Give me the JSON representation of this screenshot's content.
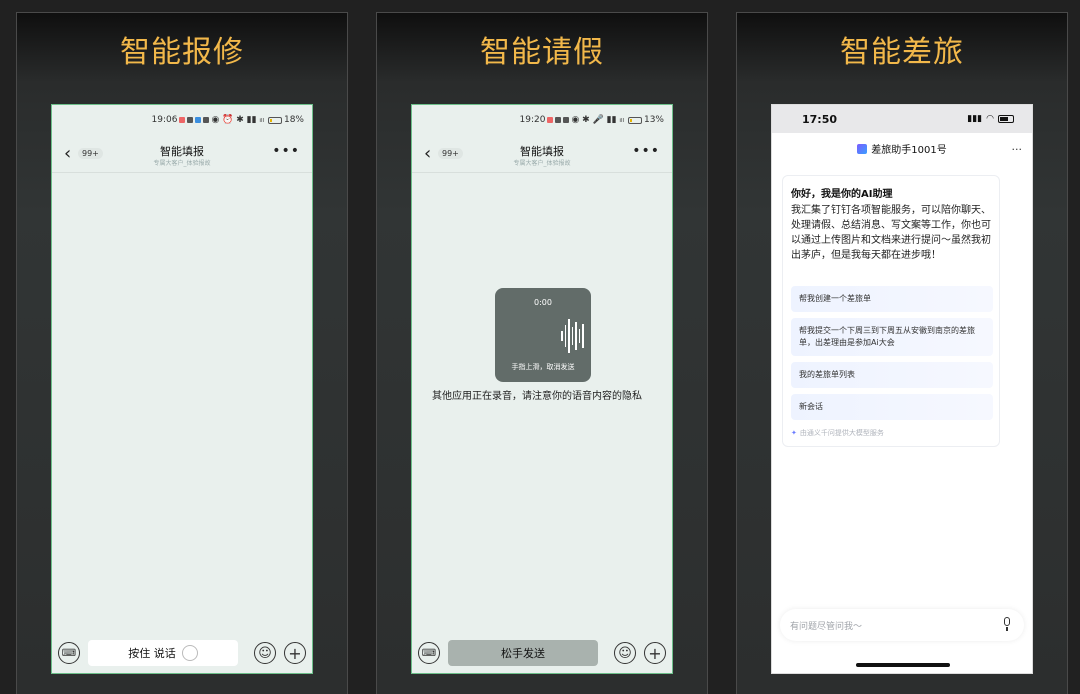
{
  "panels": [
    {
      "title": "智能报修",
      "status_time": "19:06",
      "battery": "18%",
      "battery_level": 0.18,
      "nav_title": "智能填报",
      "nav_sub": "专属大客户_体验报故",
      "badge": "99+",
      "talk_label": "按住 说话"
    },
    {
      "title": "智能请假",
      "status_time": "19:20",
      "battery": "13%",
      "battery_level": 0.13,
      "nav_title": "智能填报",
      "nav_sub": "专属大客户_体验报故",
      "badge": "99+",
      "talk_label": "松手发送",
      "recording_time": "0:00",
      "recording_hint": "手指上滑，取消发送",
      "privacy_notice": "其他应用正在录音，请注意你的语音内容的隐私"
    },
    {
      "title": "智能差旅",
      "status_time": "17:50",
      "header_title": "差旅助手1001号",
      "greeting": "你好，我是你的AI助理",
      "intro": "我汇集了钉钉各项智能服务，可以陪你聊天、处理请假、总结消息、写文案等工作，你也可以通过上传图片和文档来进行提问～虽然我初出茅庐，但是我每天都在进步哦！",
      "suggestions": [
        "帮我创建一个差旅单",
        "帮我提交一个下周三到下周五从安徽到南京的差旅单，出差理由是参加Ai大会",
        "我的差旅单列表",
        "新会话"
      ],
      "footer": "由通义千问提供大模型服务",
      "input_placeholder": "有问题尽管问我～"
    }
  ],
  "colors": {
    "title": "#f2b84a",
    "phone_bg": "#e9f0ed",
    "accent_border": "#6dbf8a"
  }
}
